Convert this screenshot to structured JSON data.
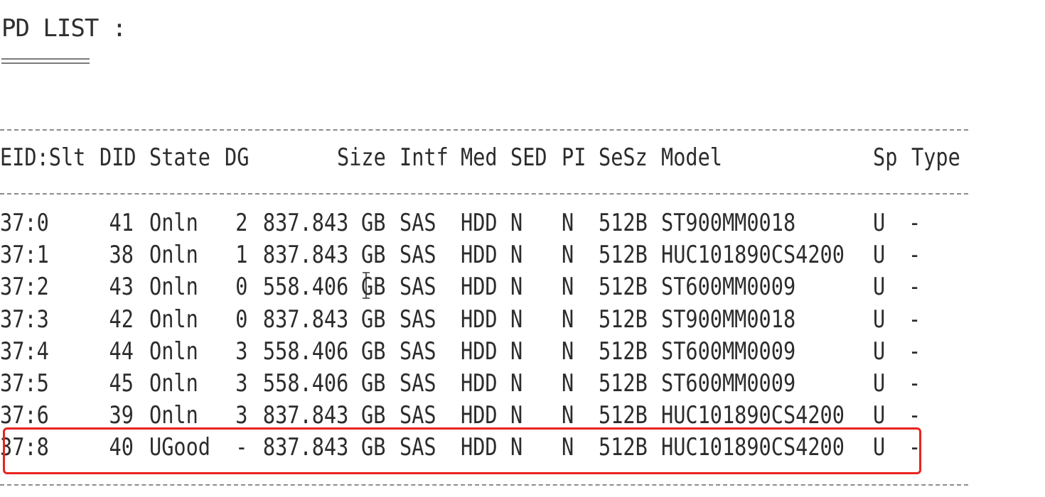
{
  "title": "PD LIST :",
  "headers": {
    "eid_slt": "EID:Slt",
    "did": "DID",
    "state": "State",
    "dg": "DG",
    "size": "Size",
    "intf": "Intf",
    "med": "Med",
    "sed": "SED",
    "pi": "PI",
    "sesz": "SeSz",
    "model": "Model",
    "sp": "Sp",
    "type": "Type"
  },
  "rows": [
    {
      "eid_slt": "37:0",
      "did": "41",
      "state": "Onln",
      "dg": "2",
      "size": "837.843",
      "unit": "GB",
      "intf": "SAS",
      "med": "HDD",
      "sed": "N",
      "pi": "N",
      "sesz": "512B",
      "model": "ST900MM0018",
      "sp": "U",
      "type": "-"
    },
    {
      "eid_slt": "37:1",
      "did": "38",
      "state": "Onln",
      "dg": "1",
      "size": "837.843",
      "unit": "GB",
      "intf": "SAS",
      "med": "HDD",
      "sed": "N",
      "pi": "N",
      "sesz": "512B",
      "model": "HUC101890CS4200",
      "sp": "U",
      "type": "-"
    },
    {
      "eid_slt": "37:2",
      "did": "43",
      "state": "Onln",
      "dg": "0",
      "size": "558.406",
      "unit": "GB",
      "intf": "SAS",
      "med": "HDD",
      "sed": "N",
      "pi": "N",
      "sesz": "512B",
      "model": "ST600MM0009",
      "sp": "U",
      "type": "-"
    },
    {
      "eid_slt": "37:3",
      "did": "42",
      "state": "Onln",
      "dg": "0",
      "size": "837.843",
      "unit": "GB",
      "intf": "SAS",
      "med": "HDD",
      "sed": "N",
      "pi": "N",
      "sesz": "512B",
      "model": "ST900MM0018",
      "sp": "U",
      "type": "-"
    },
    {
      "eid_slt": "37:4",
      "did": "44",
      "state": "Onln",
      "dg": "3",
      "size": "558.406",
      "unit": "GB",
      "intf": "SAS",
      "med": "HDD",
      "sed": "N",
      "pi": "N",
      "sesz": "512B",
      "model": "ST600MM0009",
      "sp": "U",
      "type": "-"
    },
    {
      "eid_slt": "37:5",
      "did": "45",
      "state": "Onln",
      "dg": "3",
      "size": "558.406",
      "unit": "GB",
      "intf": "SAS",
      "med": "HDD",
      "sed": "N",
      "pi": "N",
      "sesz": "512B",
      "model": "ST600MM0009",
      "sp": "U",
      "type": "-"
    },
    {
      "eid_slt": "37:6",
      "did": "39",
      "state": "Onln",
      "dg": "3",
      "size": "837.843",
      "unit": "GB",
      "intf": "SAS",
      "med": "HDD",
      "sed": "N",
      "pi": "N",
      "sesz": "512B",
      "model": "HUC101890CS4200",
      "sp": "U",
      "type": "-"
    },
    {
      "eid_slt": "37:8",
      "did": "40",
      "state": "UGood",
      "dg": "-",
      "size": "837.843",
      "unit": "GB",
      "intf": "SAS",
      "med": "HDD",
      "sed": "N",
      "pi": "N",
      "sesz": "512B",
      "model": "HUC101890CS4200",
      "sp": "U",
      "type": "-"
    }
  ],
  "highlighted_row": 7,
  "colors": {
    "highlight_box": "#e8231f",
    "text": "#2c2c2c",
    "rule": "#8c8c8c"
  },
  "icons": {
    "cursor": "text-cursor-icon"
  }
}
